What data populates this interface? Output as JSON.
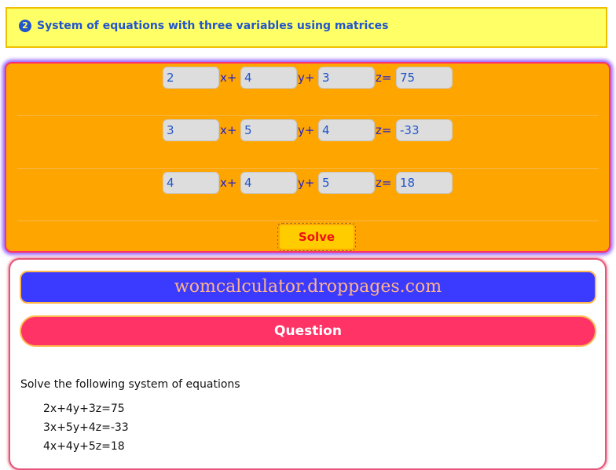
{
  "header": {
    "number": "2",
    "title": "System of equations with three variables using matrices"
  },
  "equations": [
    {
      "a": "2",
      "b": "4",
      "c": "3",
      "d": "75"
    },
    {
      "a": "3",
      "b": "5",
      "c": "4",
      "d": "-33"
    },
    {
      "a": "4",
      "b": "4",
      "c": "5",
      "d": "18"
    }
  ],
  "labels": {
    "x": "x+",
    "y": "y+",
    "z": "z="
  },
  "solve_label": "Solve",
  "result": {
    "site": "womcalculator.droppages.com",
    "question_title": "Question",
    "question_text": "Solve the following system of equations",
    "equations": [
      "2x+4y+3z=75",
      "3x+5y+4z=-33",
      "4x+4y+5z=18"
    ]
  },
  "colors": {
    "header_bg": "#ffff66",
    "panel_bg": "#ffa500",
    "site_bar": "#3b3bff",
    "question_bar": "#ff3366",
    "solve_button": "#ffcc00"
  }
}
